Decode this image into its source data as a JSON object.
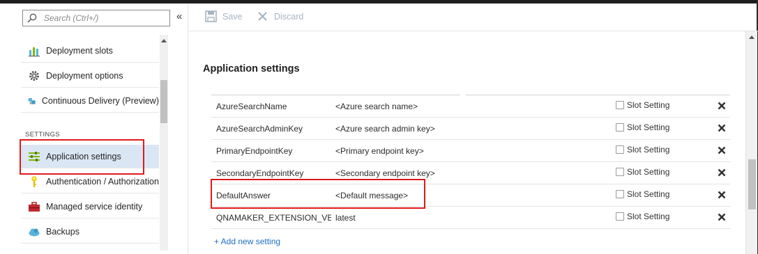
{
  "search": {
    "placeholder": "Search (Ctrl+/)"
  },
  "sidebar": {
    "collapse_glyph": "«",
    "items": [
      {
        "label": "Deployment slots",
        "icon": "deployment-slots-icon"
      },
      {
        "label": "Deployment options",
        "icon": "gear-icon"
      },
      {
        "label": "Continuous Delivery (Preview)",
        "icon": "cubes-icon"
      },
      {
        "label": "Application settings",
        "icon": "settings-sliders-icon",
        "active": true
      },
      {
        "label": "Authentication / Authorization",
        "icon": "key-icon"
      },
      {
        "label": "Managed service identity",
        "icon": "toolbox-icon"
      },
      {
        "label": "Backups",
        "icon": "cloud-icon"
      }
    ],
    "section_label": "SETTINGS"
  },
  "toolbar": {
    "save_label": "Save",
    "discard_label": "Discard"
  },
  "main": {
    "heading": "Application settings",
    "slot_setting_label": "Slot Setting",
    "rows": [
      {
        "name": "AzureSearchName",
        "value": "<Azure search name>"
      },
      {
        "name": "AzureSearchAdminKey",
        "value": "<Azure search admin key>"
      },
      {
        "name": "PrimaryEndpointKey",
        "value": "<Primary endpoint key>"
      },
      {
        "name": "SecondaryEndpointKey",
        "value": "<Secondary endpoint key>"
      },
      {
        "name": "DefaultAnswer",
        "value": "<Default message>"
      },
      {
        "name": "QNAMAKER_EXTENSION_VE...",
        "value": "latest"
      }
    ],
    "add_new_label": "+ Add new setting"
  },
  "colors": {
    "accent": "#1f6fc4",
    "active_bg": "#dbe6f4",
    "highlight_red": "#e0191b",
    "toolbar_disabled": "#a7b4c2"
  }
}
